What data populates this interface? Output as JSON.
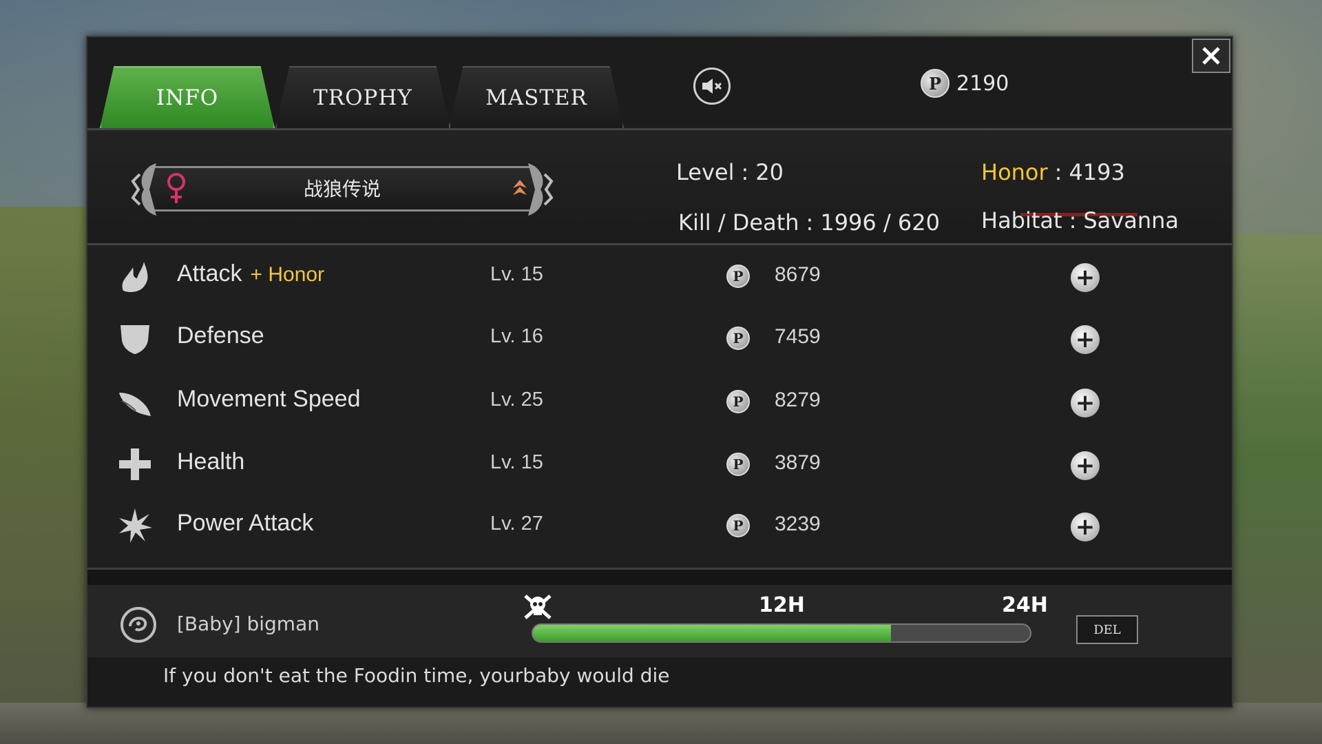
{
  "tabs": [
    {
      "label": "INFO",
      "active": true
    },
    {
      "label": "TROPHY",
      "active": false
    },
    {
      "label": "MASTER",
      "active": false
    }
  ],
  "header": {
    "points_icon": "p-coin-icon",
    "points": "2190",
    "mute_icon": "speaker-mute-icon",
    "close_icon": "close-icon"
  },
  "profile": {
    "name": "战狼传说",
    "gender_icon": "female-icon",
    "level_label": "Level",
    "level_value": "20",
    "honor_label": "Honor",
    "honor_value": "4193",
    "kd_label": "Kill / Death",
    "kd_value": "1996 / 620",
    "habitat_label": "Habitat",
    "habitat_value": "Savanna"
  },
  "stats": [
    {
      "name": "Attack",
      "extra": "+ Honor",
      "level": "Lv. 15",
      "cost": "8679",
      "icon": "claw-icon"
    },
    {
      "name": "Defense",
      "extra": "",
      "level": "Lv. 16",
      "cost": "7459",
      "icon": "shield-icon"
    },
    {
      "name": "Movement Speed",
      "extra": "",
      "level": "Lv. 25",
      "cost": "8279",
      "icon": "wing-icon"
    },
    {
      "name": "Health",
      "extra": "",
      "level": "Lv. 15",
      "cost": "3879",
      "icon": "cross-icon"
    },
    {
      "name": "Power Attack",
      "extra": "",
      "level": "Lv. 27",
      "cost": "3239",
      "icon": "burst-icon"
    }
  ],
  "baby": {
    "tag": "[Baby]",
    "name": "bigman",
    "skull_icon": "skull-crossbones-icon",
    "mark_12": "12H",
    "mark_24": "24H",
    "hunger_progress": 0.72,
    "del_label": "DEL",
    "warning": "If you don't eat the Foodin time, yourbaby would die"
  },
  "colors": {
    "active_tab": "#3f9e2e",
    "honor": "#f3c63a",
    "progress": "#5ab845"
  }
}
